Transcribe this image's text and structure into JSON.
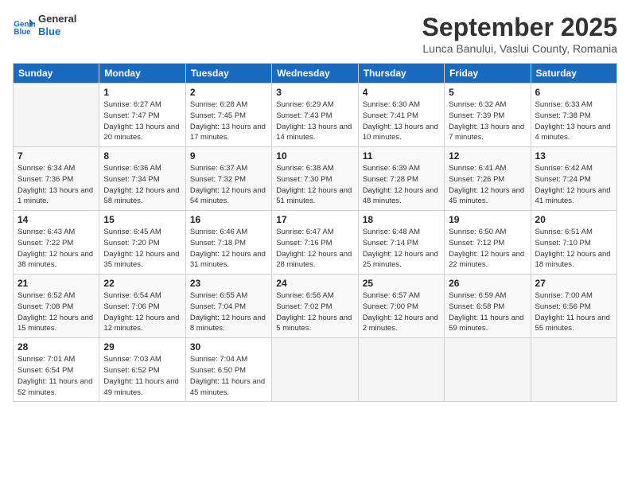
{
  "logo": {
    "line1": "General",
    "line2": "Blue"
  },
  "title": "September 2025",
  "subtitle": "Lunca Banului, Vaslui County, Romania",
  "weekdays": [
    "Sunday",
    "Monday",
    "Tuesday",
    "Wednesday",
    "Thursday",
    "Friday",
    "Saturday"
  ],
  "weeks": [
    [
      {
        "day": "",
        "sunrise": "",
        "sunset": "",
        "daylight": ""
      },
      {
        "day": "1",
        "sunrise": "Sunrise: 6:27 AM",
        "sunset": "Sunset: 7:47 PM",
        "daylight": "Daylight: 13 hours and 20 minutes."
      },
      {
        "day": "2",
        "sunrise": "Sunrise: 6:28 AM",
        "sunset": "Sunset: 7:45 PM",
        "daylight": "Daylight: 13 hours and 17 minutes."
      },
      {
        "day": "3",
        "sunrise": "Sunrise: 6:29 AM",
        "sunset": "Sunset: 7:43 PM",
        "daylight": "Daylight: 13 hours and 14 minutes."
      },
      {
        "day": "4",
        "sunrise": "Sunrise: 6:30 AM",
        "sunset": "Sunset: 7:41 PM",
        "daylight": "Daylight: 13 hours and 10 minutes."
      },
      {
        "day": "5",
        "sunrise": "Sunrise: 6:32 AM",
        "sunset": "Sunset: 7:39 PM",
        "daylight": "Daylight: 13 hours and 7 minutes."
      },
      {
        "day": "6",
        "sunrise": "Sunrise: 6:33 AM",
        "sunset": "Sunset: 7:38 PM",
        "daylight": "Daylight: 13 hours and 4 minutes."
      }
    ],
    [
      {
        "day": "7",
        "sunrise": "Sunrise: 6:34 AM",
        "sunset": "Sunset: 7:36 PM",
        "daylight": "Daylight: 13 hours and 1 minute."
      },
      {
        "day": "8",
        "sunrise": "Sunrise: 6:36 AM",
        "sunset": "Sunset: 7:34 PM",
        "daylight": "Daylight: 12 hours and 58 minutes."
      },
      {
        "day": "9",
        "sunrise": "Sunrise: 6:37 AM",
        "sunset": "Sunset: 7:32 PM",
        "daylight": "Daylight: 12 hours and 54 minutes."
      },
      {
        "day": "10",
        "sunrise": "Sunrise: 6:38 AM",
        "sunset": "Sunset: 7:30 PM",
        "daylight": "Daylight: 12 hours and 51 minutes."
      },
      {
        "day": "11",
        "sunrise": "Sunrise: 6:39 AM",
        "sunset": "Sunset: 7:28 PM",
        "daylight": "Daylight: 12 hours and 48 minutes."
      },
      {
        "day": "12",
        "sunrise": "Sunrise: 6:41 AM",
        "sunset": "Sunset: 7:26 PM",
        "daylight": "Daylight: 12 hours and 45 minutes."
      },
      {
        "day": "13",
        "sunrise": "Sunrise: 6:42 AM",
        "sunset": "Sunset: 7:24 PM",
        "daylight": "Daylight: 12 hours and 41 minutes."
      }
    ],
    [
      {
        "day": "14",
        "sunrise": "Sunrise: 6:43 AM",
        "sunset": "Sunset: 7:22 PM",
        "daylight": "Daylight: 12 hours and 38 minutes."
      },
      {
        "day": "15",
        "sunrise": "Sunrise: 6:45 AM",
        "sunset": "Sunset: 7:20 PM",
        "daylight": "Daylight: 12 hours and 35 minutes."
      },
      {
        "day": "16",
        "sunrise": "Sunrise: 6:46 AM",
        "sunset": "Sunset: 7:18 PM",
        "daylight": "Daylight: 12 hours and 31 minutes."
      },
      {
        "day": "17",
        "sunrise": "Sunrise: 6:47 AM",
        "sunset": "Sunset: 7:16 PM",
        "daylight": "Daylight: 12 hours and 28 minutes."
      },
      {
        "day": "18",
        "sunrise": "Sunrise: 6:48 AM",
        "sunset": "Sunset: 7:14 PM",
        "daylight": "Daylight: 12 hours and 25 minutes."
      },
      {
        "day": "19",
        "sunrise": "Sunrise: 6:50 AM",
        "sunset": "Sunset: 7:12 PM",
        "daylight": "Daylight: 12 hours and 22 minutes."
      },
      {
        "day": "20",
        "sunrise": "Sunrise: 6:51 AM",
        "sunset": "Sunset: 7:10 PM",
        "daylight": "Daylight: 12 hours and 18 minutes."
      }
    ],
    [
      {
        "day": "21",
        "sunrise": "Sunrise: 6:52 AM",
        "sunset": "Sunset: 7:08 PM",
        "daylight": "Daylight: 12 hours and 15 minutes."
      },
      {
        "day": "22",
        "sunrise": "Sunrise: 6:54 AM",
        "sunset": "Sunset: 7:06 PM",
        "daylight": "Daylight: 12 hours and 12 minutes."
      },
      {
        "day": "23",
        "sunrise": "Sunrise: 6:55 AM",
        "sunset": "Sunset: 7:04 PM",
        "daylight": "Daylight: 12 hours and 8 minutes."
      },
      {
        "day": "24",
        "sunrise": "Sunrise: 6:56 AM",
        "sunset": "Sunset: 7:02 PM",
        "daylight": "Daylight: 12 hours and 5 minutes."
      },
      {
        "day": "25",
        "sunrise": "Sunrise: 6:57 AM",
        "sunset": "Sunset: 7:00 PM",
        "daylight": "Daylight: 12 hours and 2 minutes."
      },
      {
        "day": "26",
        "sunrise": "Sunrise: 6:59 AM",
        "sunset": "Sunset: 6:58 PM",
        "daylight": "Daylight: 11 hours and 59 minutes."
      },
      {
        "day": "27",
        "sunrise": "Sunrise: 7:00 AM",
        "sunset": "Sunset: 6:56 PM",
        "daylight": "Daylight: 11 hours and 55 minutes."
      }
    ],
    [
      {
        "day": "28",
        "sunrise": "Sunrise: 7:01 AM",
        "sunset": "Sunset: 6:54 PM",
        "daylight": "Daylight: 11 hours and 52 minutes."
      },
      {
        "day": "29",
        "sunrise": "Sunrise: 7:03 AM",
        "sunset": "Sunset: 6:52 PM",
        "daylight": "Daylight: 11 hours and 49 minutes."
      },
      {
        "day": "30",
        "sunrise": "Sunrise: 7:04 AM",
        "sunset": "Sunset: 6:50 PM",
        "daylight": "Daylight: 11 hours and 45 minutes."
      },
      {
        "day": "",
        "sunrise": "",
        "sunset": "",
        "daylight": ""
      },
      {
        "day": "",
        "sunrise": "",
        "sunset": "",
        "daylight": ""
      },
      {
        "day": "",
        "sunrise": "",
        "sunset": "",
        "daylight": ""
      },
      {
        "day": "",
        "sunrise": "",
        "sunset": "",
        "daylight": ""
      }
    ]
  ]
}
